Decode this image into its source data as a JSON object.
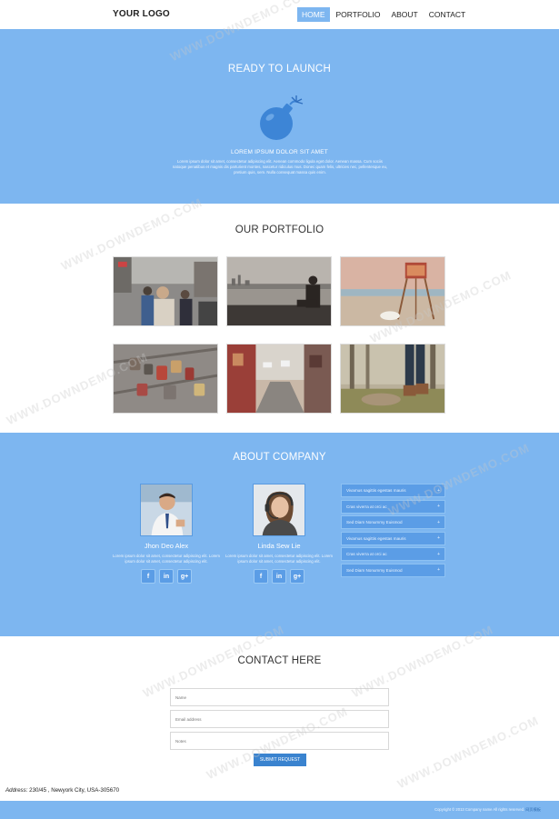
{
  "header": {
    "logo": "YOUR LOGO",
    "nav": [
      {
        "label": "HOME",
        "active": true
      },
      {
        "label": "PORTFOLIO",
        "active": false
      },
      {
        "label": "ABOUT",
        "active": false
      },
      {
        "label": "CONTACT",
        "active": false
      }
    ]
  },
  "hero": {
    "title": "READY TO LAUNCH",
    "icon": "bomb-icon",
    "subtitle": "LOREM IPSUM DOLOR SIT AMET",
    "text": "Lorem ipsum dolor sit amet, consectetur adipiscing elit. Aenean commodo ligula eget dolor. Aenean massa. Cum sociis natoque penatibus et magnis dis parturient montes, nascetur ridiculus mus. Donec quam felis, ultricies nec, pellentesque eu, pretium quis, sem. Nulla consequat massa quis enim."
  },
  "portfolio": {
    "title": "OUR PORTFOLIO",
    "images": [
      "street-crowd-photo",
      "city-waterfront-photo",
      "lifeguard-tower-photo",
      "love-locks-photo",
      "narrow-street-photo",
      "forest-boots-photo"
    ]
  },
  "about": {
    "title": "ABOUT COMPANY",
    "members": [
      {
        "name": "Jhon Deo Alex",
        "text": "Lorem ipsum dolor sit amet, consectetur adipiscing elit. Lorem ipsum dolor sit amet, consectetur adipiscing elit."
      },
      {
        "name": "Linda Sew Lie",
        "text": "Lorem ipsum dolor sit amet, consectetur adipiscing elit. Lorem ipsum dolor sit amet, consectetur adipiscing elit."
      }
    ],
    "social": [
      "f",
      "in",
      "g+"
    ],
    "accordion": [
      "Vivamus sagittis egestas mauris",
      "Cras viverra at orci ac",
      "Sed Diam Nonummy Euismod",
      "Vivamus sagittis egestas mauris",
      "Cras viverra at orci ac",
      "Sed Diam Nonummy Euismod"
    ]
  },
  "contact": {
    "title": "CONTACT HERE",
    "name_placeholder": "Name",
    "email_placeholder": "Email address",
    "notes_placeholder": "Notes",
    "submit_label": "SUBMIT REQUEST"
  },
  "address": {
    "label": "Address:",
    "value": " 230/45 , Newyork City, USA-305670"
  },
  "footer": {
    "copyright": "Copyright © 2013 Company name All rights reserved.",
    "link": "网页模板"
  },
  "watermark": "WWW.DOWNDEMO.COM",
  "colors": {
    "accent": "#7db6f0",
    "accent_dark": "#5b9de6",
    "button": "#3a83cf"
  }
}
